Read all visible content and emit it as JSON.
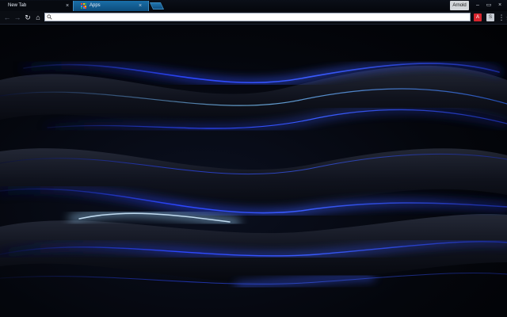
{
  "tabs": [
    {
      "label": "New Tab",
      "close": "×"
    },
    {
      "label": "Apps",
      "close": "×"
    }
  ],
  "profile": {
    "name": "Arnold"
  },
  "window_controls": {
    "minimize": "–",
    "maximize": "▭",
    "close": "×"
  },
  "toolbar": {
    "back": "←",
    "forward": "→",
    "reload": "↻",
    "home": "⌂",
    "star": "☆",
    "menu": "⋮",
    "ext_1": "A",
    "ext_2": "S"
  },
  "omnibox": {
    "value": "",
    "placeholder": ""
  },
  "colors": {
    "accent": "#1a6ea8",
    "wave_blue": "#2b46ff",
    "wave_cyan": "#7ec8ff"
  },
  "icons": [
    "search-icon",
    "apps-grid-icon",
    "star-icon",
    "menu-icon",
    "back-icon",
    "forward-icon",
    "reload-icon",
    "home-icon"
  ]
}
